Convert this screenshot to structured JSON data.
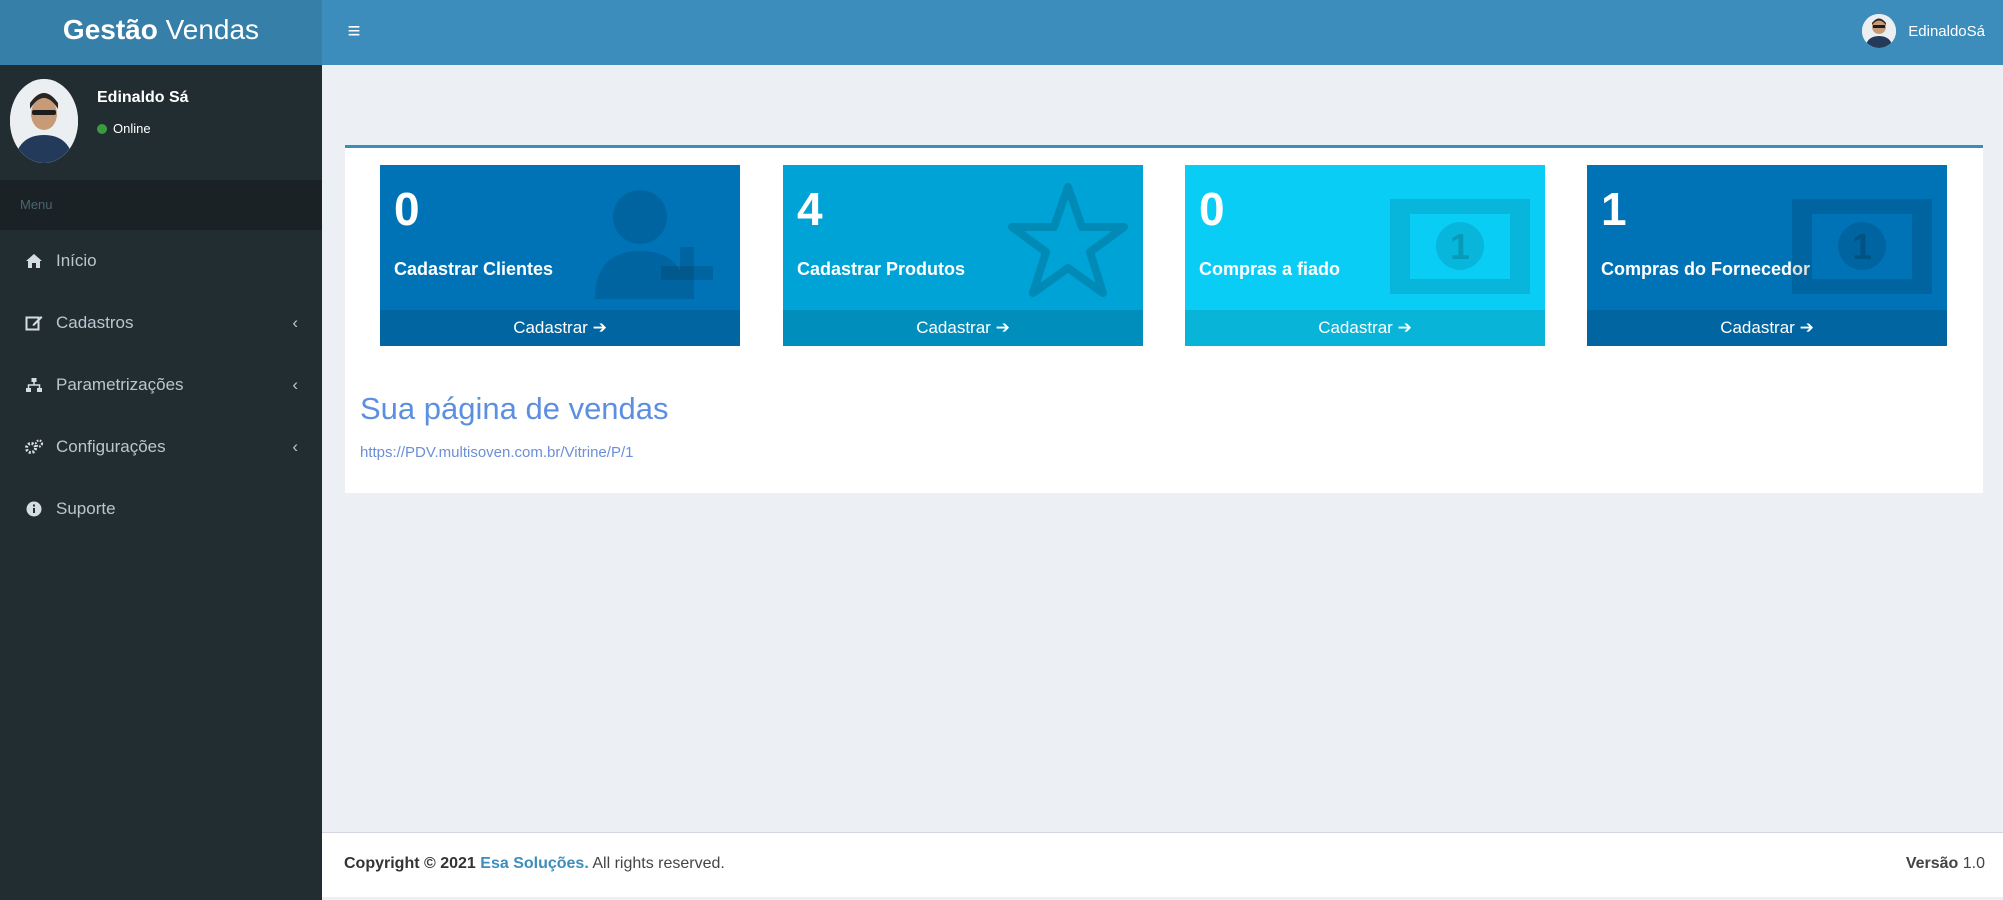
{
  "header": {
    "brand_bold": "Gestão",
    "brand_rest": "Vendas",
    "menu_toggle_icon": "hamburger-icon",
    "user_name": "EdinaldoSá"
  },
  "sidebar": {
    "user_name": "Edinaldo Sá",
    "status": "Online",
    "menu_header": "Menu",
    "items": [
      {
        "label": "Início",
        "icon": "home-icon"
      },
      {
        "label": "Cadastros",
        "icon": "edit-icon",
        "has_children": true
      },
      {
        "label": "Parametrizações",
        "icon": "sitemap-icon",
        "has_children": true
      },
      {
        "label": "Configurações",
        "icon": "gears-icon",
        "has_children": true
      },
      {
        "label": "Suporte",
        "icon": "info-icon"
      }
    ]
  },
  "tiles": [
    {
      "count": "0",
      "label": "Cadastrar Clientes",
      "action": "Cadastrar",
      "icon": "user-plus-icon",
      "color": "#0073b7"
    },
    {
      "count": "4",
      "label": "Cadastrar Produtos",
      "action": "Cadastrar",
      "icon": "star-icon",
      "color": "#00a3d6"
    },
    {
      "count": "0",
      "label": "Compras a fiado",
      "action": "Cadastrar",
      "icon": "money-icon",
      "color": "#0acdf6"
    },
    {
      "count": "1",
      "label": "Compras do Fornecedor",
      "action": "Cadastrar",
      "icon": "money-icon",
      "color": "#0073b7"
    }
  ],
  "sales_page": {
    "title": "Sua página de vendas",
    "url": "https://PDV.multisoven.com.br/Vitrine/P/1"
  },
  "footer": {
    "copyright": "Copyright © 2021",
    "company": "Esa Soluções.",
    "rights": "All rights reserved.",
    "version_label": "Versão",
    "version": "1.0"
  },
  "colors": {
    "header": "#3c8dbc",
    "logo_bg": "#367fa9",
    "sidebar": "#222d32",
    "content_bg": "#ecf0f5",
    "status_online": "#3c9a3f"
  }
}
